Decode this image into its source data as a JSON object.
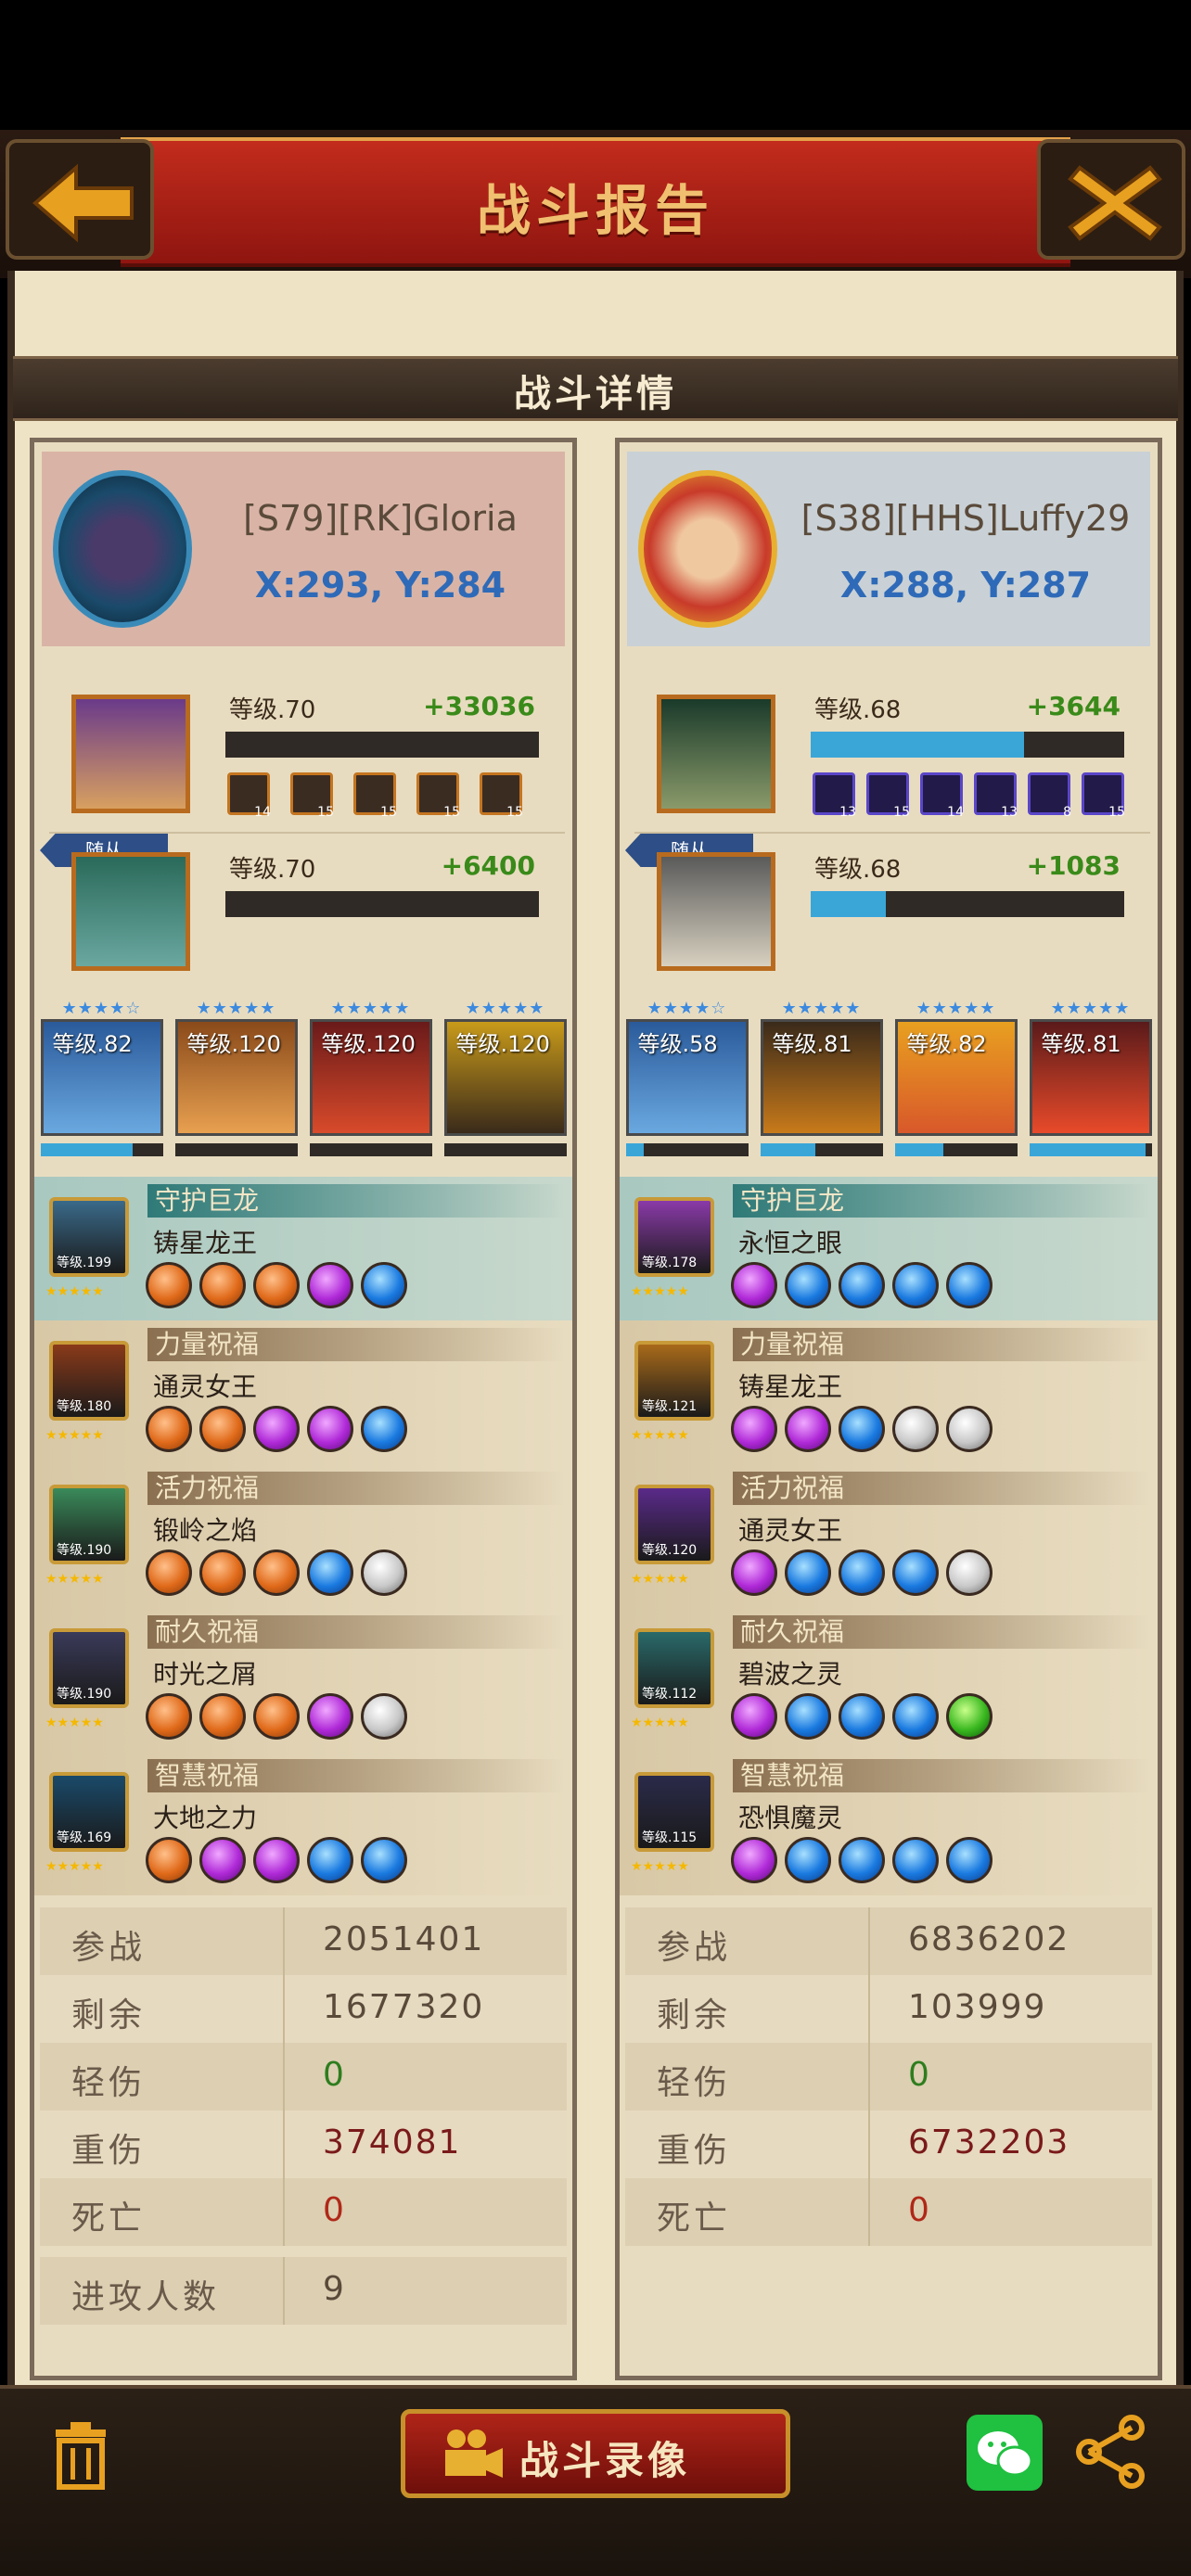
{
  "header": {
    "title": "战斗报告",
    "subtitle": "战斗详情"
  },
  "left": {
    "name": "[S79][RK]Gloria",
    "coord": "X:293, Y:284",
    "hero": {
      "level": "等级.70",
      "gain": "+33036",
      "bar": 0,
      "items": [
        "14",
        "15",
        "15",
        "15",
        "15"
      ]
    },
    "follower": {
      "label": "随从",
      "level": "等级.70",
      "gain": "+6400",
      "bar": 0
    },
    "troops": [
      {
        "level": "等级.82",
        "stars": "★★★★☆",
        "exp": 0.75
      },
      {
        "level": "等级.120",
        "stars": "★★★★★",
        "exp": 0.0
      },
      {
        "level": "等级.120",
        "stars": "★★★★★",
        "exp": 0.0
      },
      {
        "level": "等级.120",
        "stars": "★★★★★",
        "exp": 0.0
      }
    ],
    "dragons": [
      {
        "role": "守护巨龙",
        "name": "铸星龙王",
        "dlevel": "等级.199",
        "gems": [
          "orange",
          "orange",
          "orange",
          "purple",
          "blue"
        ]
      },
      {
        "role": "力量祝福",
        "name": "通灵女王",
        "dlevel": "等级.180",
        "gems": [
          "orange",
          "orange",
          "purple",
          "purple",
          "blue"
        ]
      },
      {
        "role": "活力祝福",
        "name": "锻岭之焰",
        "dlevel": "等级.190",
        "gems": [
          "orange",
          "orange",
          "orange",
          "blue",
          "white"
        ]
      },
      {
        "role": "耐久祝福",
        "name": "时光之屑",
        "dlevel": "等级.190",
        "gems": [
          "orange",
          "orange",
          "orange",
          "purple",
          "white"
        ]
      },
      {
        "role": "智慧祝福",
        "name": "大地之力",
        "dlevel": "等级.169",
        "gems": [
          "orange",
          "purple",
          "purple",
          "blue",
          "blue"
        ]
      }
    ],
    "stats": [
      {
        "label": "参战",
        "value": "2051401"
      },
      {
        "label": "剩余",
        "value": "1677320"
      },
      {
        "label": "轻伤",
        "value": "0"
      },
      {
        "label": "重伤",
        "value": "374081"
      },
      {
        "label": "死亡",
        "value": "0"
      }
    ],
    "attackers": {
      "label": "进攻人数",
      "value": "9"
    }
  },
  "right": {
    "name": "[S38][HHS]Luffy29",
    "coord": "X:288, Y:287",
    "hero": {
      "level": "等级.68",
      "gain": "+3644",
      "bar": 0.68,
      "items": [
        "13",
        "15",
        "14",
        "13",
        "8",
        "15"
      ]
    },
    "follower": {
      "label": "随从",
      "level": "等级.68",
      "gain": "+1083",
      "bar": 0.24
    },
    "troops": [
      {
        "level": "等级.58",
        "stars": "★★★★☆",
        "exp": 0.15
      },
      {
        "level": "等级.81",
        "stars": "★★★★★",
        "exp": 0.45
      },
      {
        "level": "等级.82",
        "stars": "★★★★★",
        "exp": 0.4
      },
      {
        "level": "等级.81",
        "stars": "★★★★★",
        "exp": 0.95
      }
    ],
    "dragons": [
      {
        "role": "守护巨龙",
        "name": "永恒之眼",
        "dlevel": "等级.178",
        "gems": [
          "purple",
          "blue",
          "blue",
          "blue",
          "blue"
        ]
      },
      {
        "role": "力量祝福",
        "name": "铸星龙王",
        "dlevel": "等级.121",
        "gems": [
          "purple",
          "purple",
          "blue",
          "white",
          "white"
        ]
      },
      {
        "role": "活力祝福",
        "name": "通灵女王",
        "dlevel": "等级.120",
        "gems": [
          "purple",
          "blue",
          "blue",
          "blue",
          "white"
        ]
      },
      {
        "role": "耐久祝福",
        "name": "碧波之灵",
        "dlevel": "等级.112",
        "gems": [
          "purple",
          "blue",
          "blue",
          "blue",
          "green"
        ]
      },
      {
        "role": "智慧祝福",
        "name": "恐惧魔灵",
        "dlevel": "等级.115",
        "gems": [
          "purple",
          "blue",
          "blue",
          "blue",
          "blue"
        ]
      }
    ],
    "stats": [
      {
        "label": "参战",
        "value": "6836202"
      },
      {
        "label": "剩余",
        "value": "103999"
      },
      {
        "label": "轻伤",
        "value": "0"
      },
      {
        "label": "重伤",
        "value": "6732203"
      },
      {
        "label": "死亡",
        "value": "0"
      }
    ]
  },
  "footer": {
    "record_label": "战斗录像"
  }
}
